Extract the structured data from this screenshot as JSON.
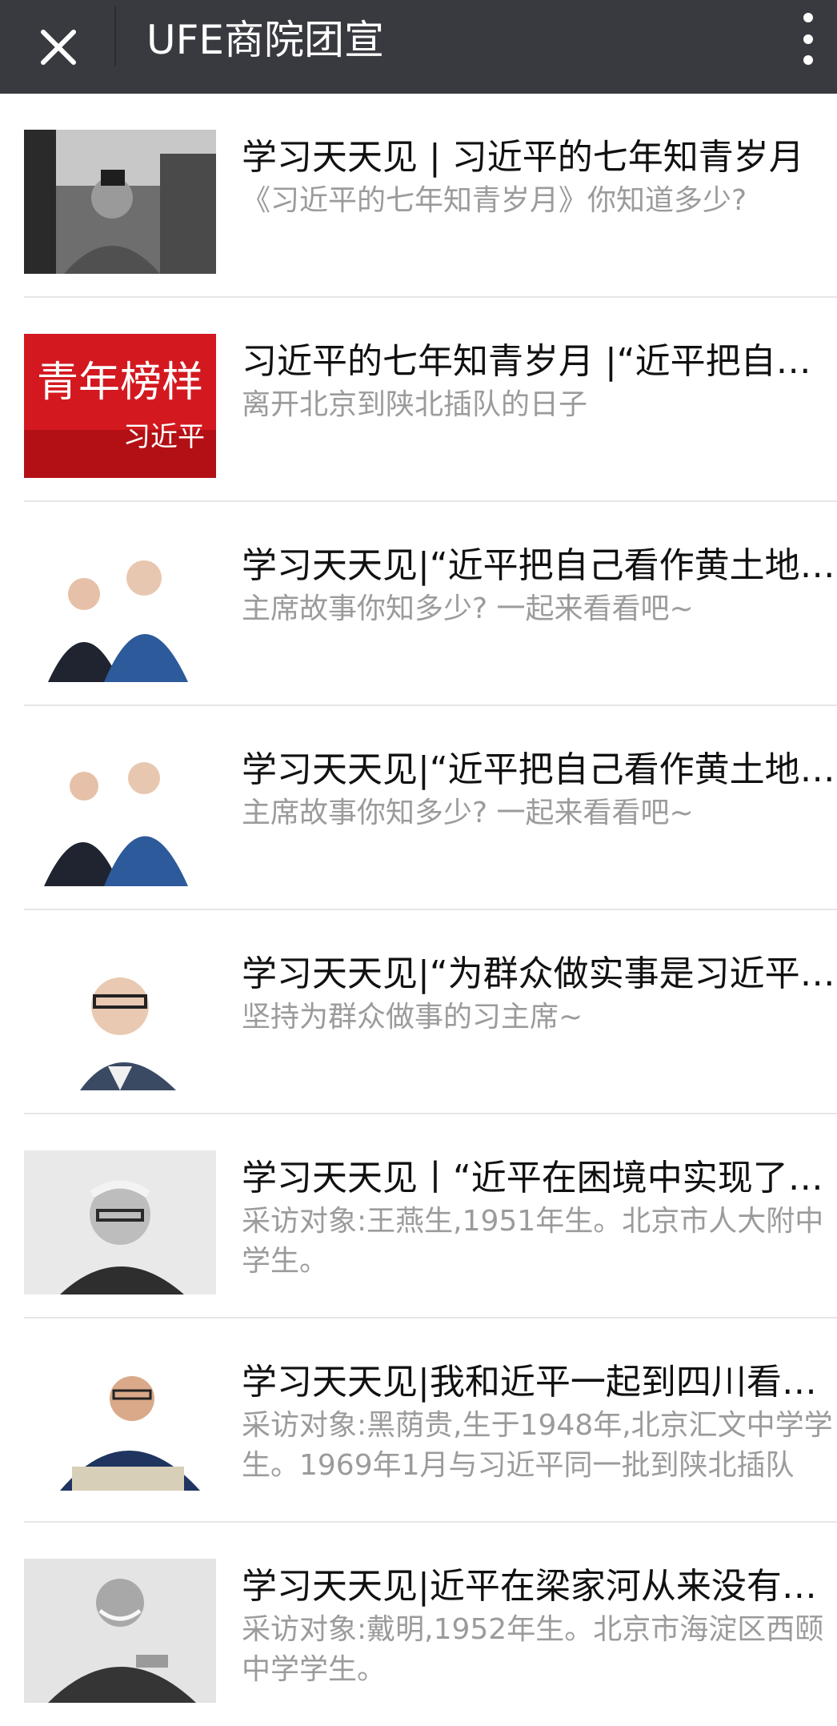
{
  "header": {
    "title": "UFE商院团宣",
    "close_icon": "close-icon",
    "more_icon": "more-vertical-icon",
    "background": "#393a3f"
  },
  "articles": [
    {
      "title": "学习天天见 | 习近平的七年知青岁月",
      "summary": "《习近平的七年知青岁月》你知道多少?",
      "thumbnail": "bw-portrait-young-man"
    },
    {
      "title": "习近平的七年知青岁月 |“近平把自己看作黄土地的一部分”",
      "summary": "离开北京到陕北插队的日子",
      "thumbnail": "red-banner",
      "thumbnail_text": [
        "青年榜样",
        "习近平"
      ]
    },
    {
      "title": "学习天天见|“近平把自己看作黄土地的一部分”",
      "summary": "主席故事你知多少?  一起来看看吧~",
      "thumbnail": "two-men-photo"
    },
    {
      "title": "学习天天见|“近平把自己看作黄土地的一部分”",
      "summary": "主席故事你知多少?  一起来看看吧~",
      "thumbnail": "two-men-photo"
    },
    {
      "title": "学习天天见|“为群众做实事是习近平的追求”",
      "summary": "坚持为群众做事的习主席~",
      "thumbnail": "portrait-glasses"
    },
    {
      "title": "学习天天见丨“近平在困境中实现了自我超越”",
      "summary": "采访对象:王燕生,1951年生。北京市人大附中学生。",
      "thumbnail": "portrait-elderly"
    },
    {
      "title": "学习天天见|我和近平一起到四川看沼气",
      "summary": "采访对象:黑荫贵,生于1948年,北京汇文中学学生。1969年1月与习近平同一批到陕北插队",
      "thumbnail": "portrait-seated"
    },
    {
      "title": "学习天天见|近平在梁家河从来没有闲着",
      "summary": "采访对象:戴明,1952年生。北京市海淀区西颐中学学生。",
      "thumbnail": "portrait-smiling"
    }
  ]
}
